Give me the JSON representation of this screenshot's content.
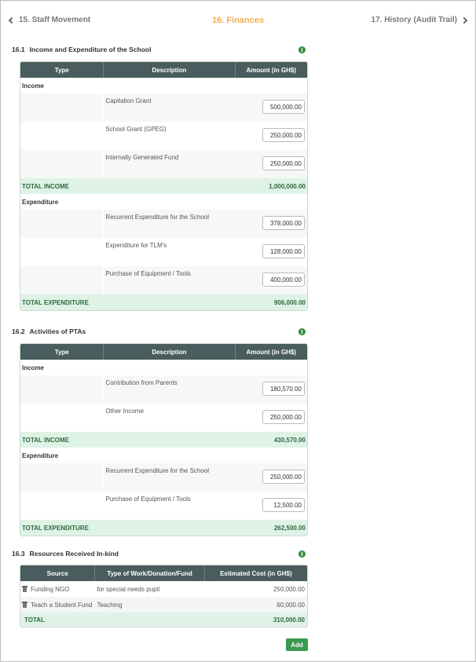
{
  "nav": {
    "prev_label": "15. Staff Movement",
    "title": "16. Finances",
    "next_label": "17. History (Audit Trail)"
  },
  "colors": {
    "accent": "#f0ad4e",
    "header": "#495c5e",
    "total_bg": "#dff2e6",
    "button": "#3a9a4f"
  },
  "income_expenditure": {
    "number": "16.1",
    "title": "Income and Expenditure of the School",
    "columns": [
      "Type",
      "Description",
      "Amount (in GH$)"
    ],
    "income_label": "Income",
    "income_rows": [
      {
        "description": "Capitation Grant",
        "amount": "500,000.00"
      },
      {
        "description": "School Grant (GPEG)",
        "amount": "250,000.00"
      },
      {
        "description": "Internally Generated Fund",
        "amount": "250,000.00"
      }
    ],
    "total_income_label": "TOTAL INCOME",
    "total_income": "1,000,000.00",
    "expenditure_label": "Expenditure",
    "expenditure_rows": [
      {
        "description": "Recurrent Expenditure for the School",
        "amount": "378,000.00"
      },
      {
        "description": "Expenditure for TLM's",
        "amount": "128,000.00"
      },
      {
        "description": "Purchase of Equipment / Tools",
        "amount": "400,000.00"
      }
    ],
    "total_expenditure_label": "TOTAL EXPENDITURE",
    "total_expenditure": "906,000.00"
  },
  "pta": {
    "number": "16.2",
    "title": "Activities of PTAs",
    "columns": [
      "Type",
      "Description",
      "Amount (in GH$)"
    ],
    "income_label": "Income",
    "income_rows": [
      {
        "description": "Contribution from Parents",
        "amount": "180,570.00"
      },
      {
        "description": "Other Income",
        "amount": "250,000.00"
      }
    ],
    "total_income_label": "TOTAL INCOME",
    "total_income": "430,570.00",
    "expenditure_label": "Expenditure",
    "expenditure_rows": [
      {
        "description": "Recurrent Expenditure for the School",
        "amount": "250,000.00"
      },
      {
        "description": "Purchase of Equipment / Tools",
        "amount": "12,500.00"
      }
    ],
    "total_expenditure_label": "TOTAL EXPENDITURE",
    "total_expenditure": "262,500.00"
  },
  "resources": {
    "number": "16.3",
    "title": "Resources Received In-kind",
    "columns": [
      "Source",
      "Type of Work/Donation/Fund",
      "Estimated Cost (in GH$)"
    ],
    "rows": [
      {
        "source": "Funding NGO",
        "type": "for special needs pupil",
        "cost": "250,000.00"
      },
      {
        "source": "Teach a Student Fund",
        "type": "Teaching",
        "cost": "60,000.00"
      }
    ],
    "total_label": "TOTAL",
    "total": "310,000.00",
    "add_label": "Add"
  }
}
